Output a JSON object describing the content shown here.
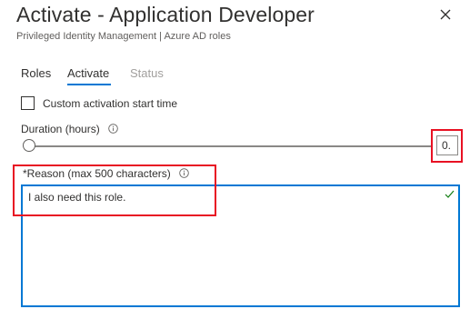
{
  "header": {
    "title": "Activate - Application Developer",
    "subtitle": "Privileged Identity Management | Azure AD roles"
  },
  "tabs": [
    {
      "label": "Roles",
      "active": false,
      "disabled": false
    },
    {
      "label": "Activate",
      "active": true,
      "disabled": false
    },
    {
      "label": "Status",
      "active": false,
      "disabled": true
    }
  ],
  "custom_start": {
    "label": "Custom activation start time",
    "checked": false
  },
  "duration": {
    "label": "Duration (hours)",
    "value": "0.",
    "slider_fraction": 0.0
  },
  "reason": {
    "label": "*Reason (max 500 characters)",
    "value": "I also need this role.",
    "valid": true
  },
  "colors": {
    "accent": "#0078d4",
    "highlight_box": "#e81123",
    "valid_check": "#107c10",
    "disabled_text": "#a19f9d"
  },
  "icons": [
    "close-icon",
    "info-icon",
    "check-icon"
  ]
}
